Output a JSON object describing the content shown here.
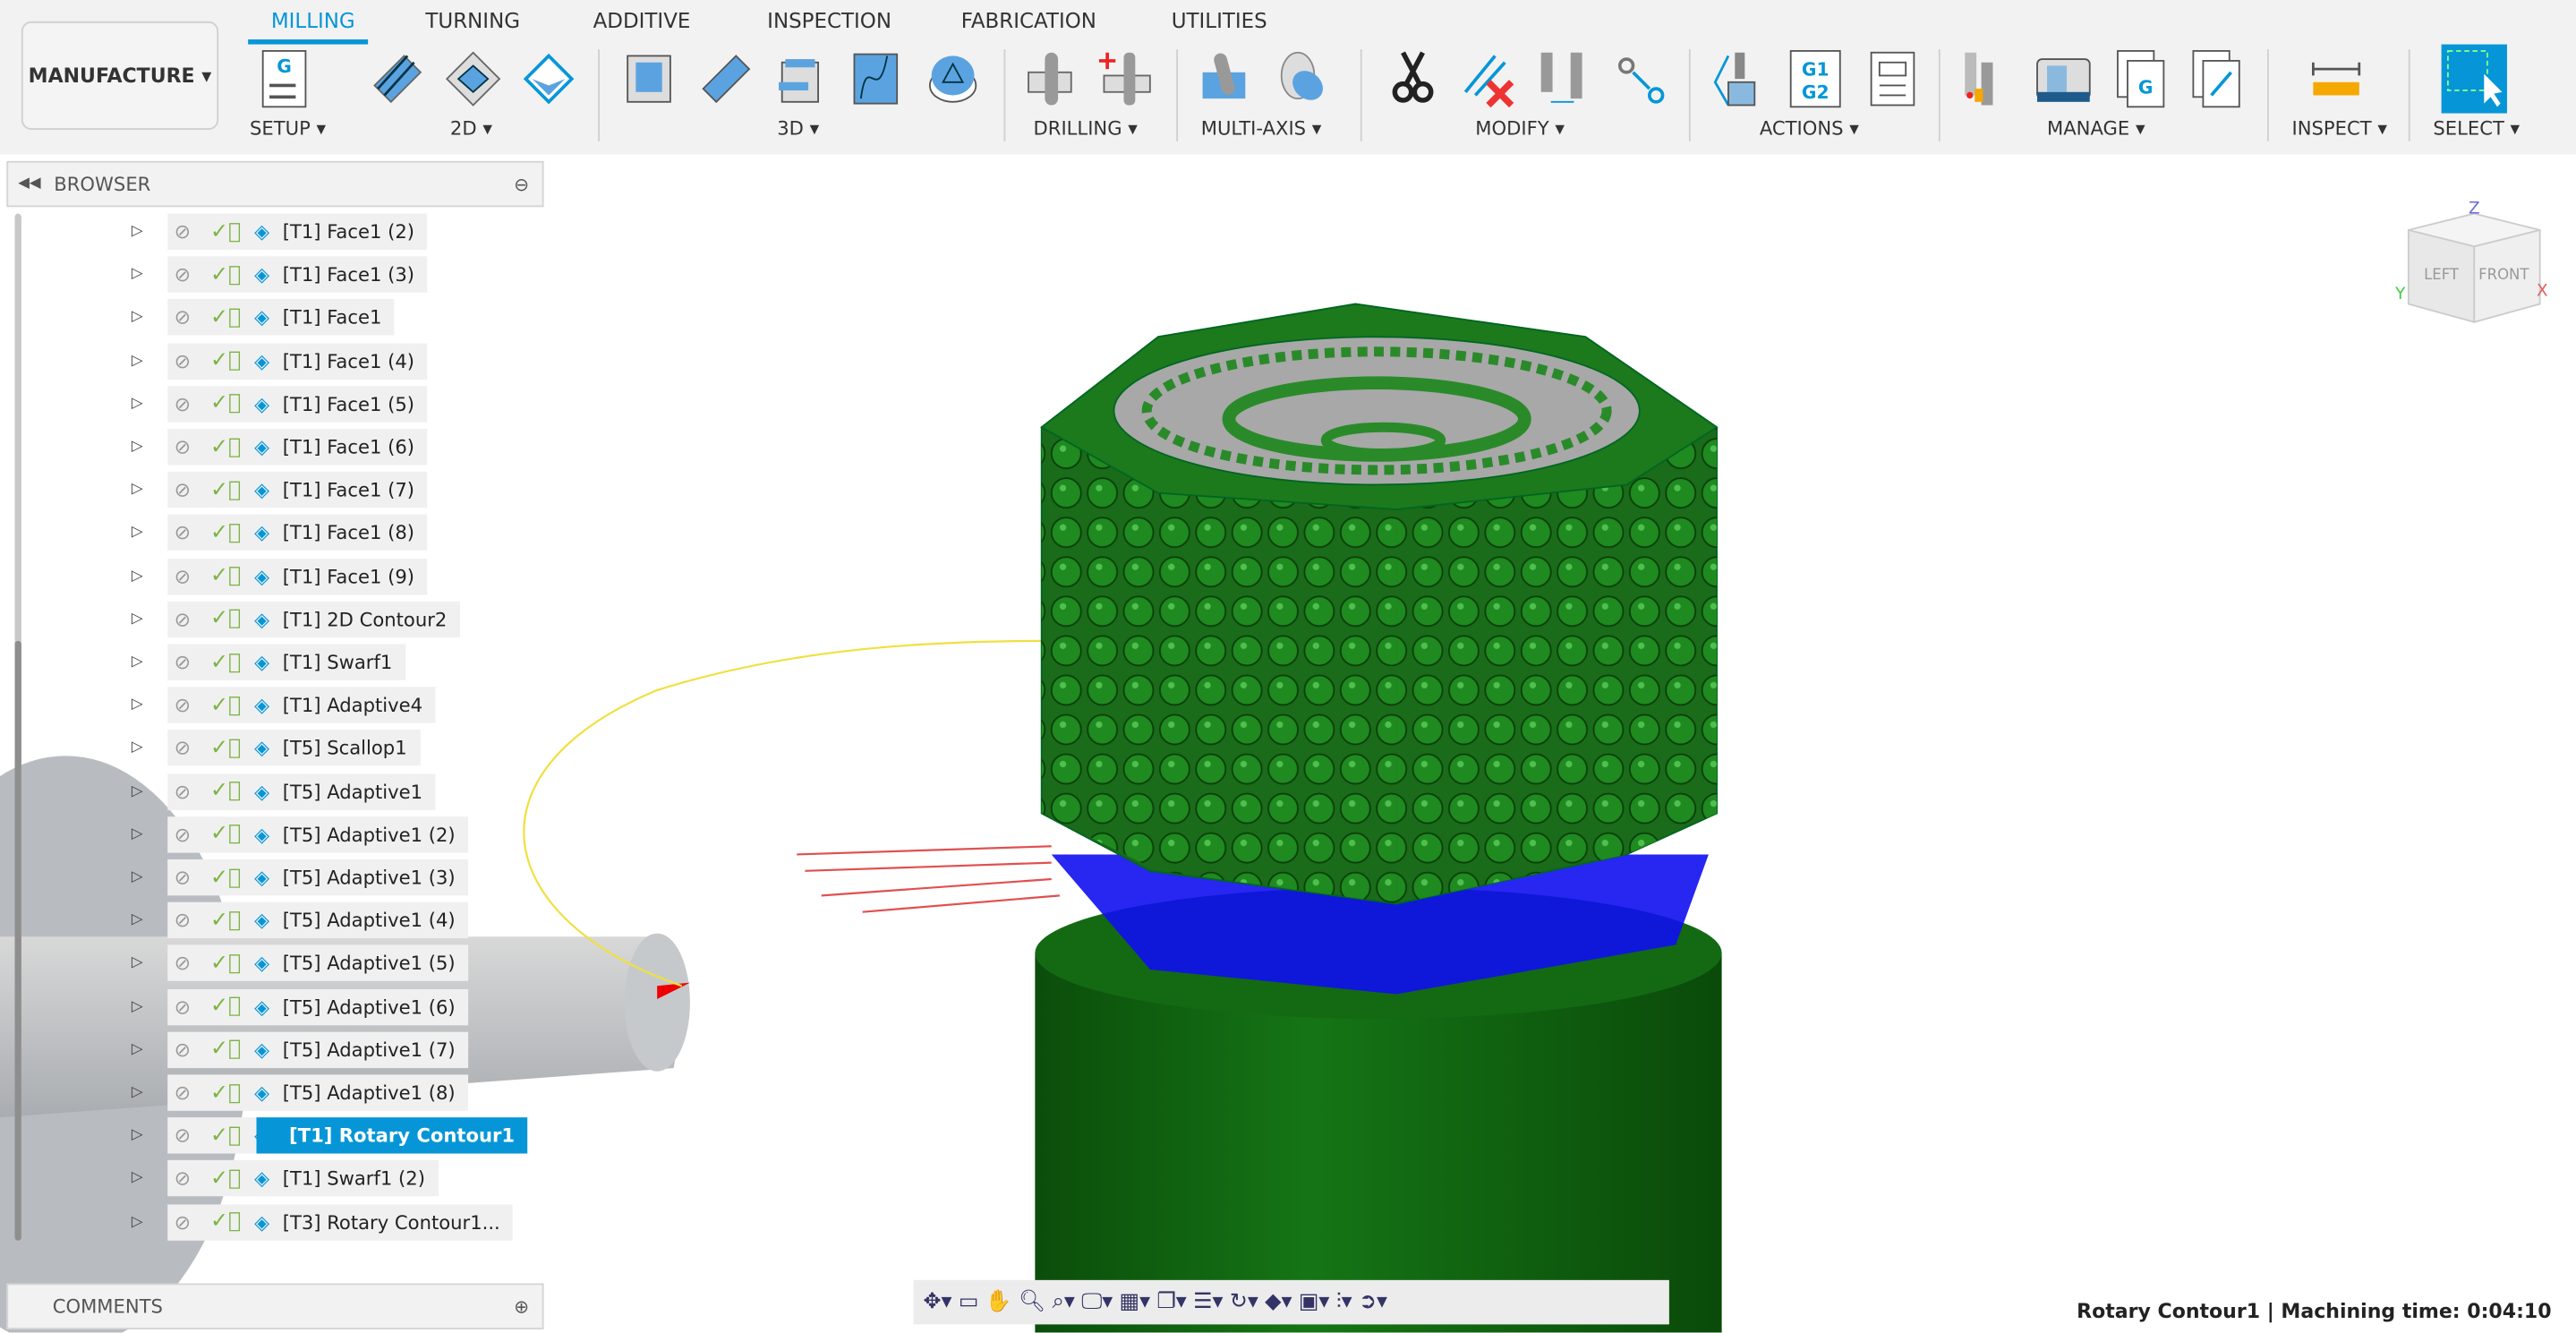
{
  "workspace": "MANUFACTURE",
  "tabs": [
    {
      "label": "MILLING",
      "active": true
    },
    {
      "label": "TURNING"
    },
    {
      "label": "ADDITIVE"
    },
    {
      "label": "INSPECTION"
    },
    {
      "label": "FABRICATION"
    },
    {
      "label": "UTILITIES"
    }
  ],
  "groups": [
    {
      "label": "SETUP"
    },
    {
      "label": "2D"
    },
    {
      "label": "3D"
    },
    {
      "label": "DRILLING"
    },
    {
      "label": "MULTI-AXIS"
    },
    {
      "label": "MODIFY"
    },
    {
      "label": "ACTIONS"
    },
    {
      "label": "MANAGE"
    },
    {
      "label": "INSPECT"
    },
    {
      "label": "SELECT"
    }
  ],
  "icon_text": {
    "setup_g": "G",
    "actions_g1": "G1",
    "actions_g2": "G2",
    "manage_g": "G"
  },
  "browser": {
    "title": "BROWSER",
    "items": [
      {
        "label": "[T1] Face1 (2)",
        "icon": "face-icon"
      },
      {
        "label": "[T1] Face1 (3)",
        "icon": "face-icon"
      },
      {
        "label": "[T1] Face1",
        "icon": "face-icon"
      },
      {
        "label": "[T1] Face1 (4)",
        "icon": "face-icon"
      },
      {
        "label": "[T1] Face1 (5)",
        "icon": "face-icon"
      },
      {
        "label": "[T1] Face1 (6)",
        "icon": "face-icon"
      },
      {
        "label": "[T1] Face1 (7)",
        "icon": "face-icon"
      },
      {
        "label": "[T1] Face1 (8)",
        "icon": "face-icon"
      },
      {
        "label": "[T1] Face1 (9)",
        "icon": "face-icon"
      },
      {
        "label": "[T1] 2D Contour2",
        "icon": "contour-icon"
      },
      {
        "label": "[T1] Swarf1",
        "icon": "swarf-icon"
      },
      {
        "label": "[T1] Adaptive4",
        "icon": "adaptive-icon"
      },
      {
        "label": "[T5] Scallop1",
        "icon": "scallop-icon"
      },
      {
        "label": "[T5] Adaptive1",
        "icon": "adaptive-icon"
      },
      {
        "label": "[T5] Adaptive1 (2)",
        "icon": "adaptive-icon"
      },
      {
        "label": "[T5] Adaptive1 (3)",
        "icon": "adaptive-icon"
      },
      {
        "label": "[T5] Adaptive1 (4)",
        "icon": "adaptive-icon"
      },
      {
        "label": "[T5] Adaptive1 (5)",
        "icon": "adaptive-icon"
      },
      {
        "label": "[T5] Adaptive1 (6)",
        "icon": "adaptive-icon"
      },
      {
        "label": "[T5] Adaptive1 (7)",
        "icon": "adaptive-icon"
      },
      {
        "label": "[T5] Adaptive1 (8)",
        "icon": "adaptive-icon"
      },
      {
        "label": "[T1] Rotary Contour1",
        "icon": "rotary-icon",
        "selected": true
      },
      {
        "label": "[T1] Swarf1 (2)",
        "icon": "swarf-icon"
      },
      {
        "label": "[T3] Rotary Contour1...",
        "icon": "rotary-icon"
      }
    ]
  },
  "comments": {
    "title": "COMMENTS"
  },
  "viewcube": {
    "left": "LEFT",
    "front": "FRONT",
    "z": "Z",
    "x": "X",
    "y": "Y"
  },
  "status": "Rotary Contour1 | Machining time: 0:04:10",
  "colors": {
    "accent": "#0696d7",
    "part": "#1a7a1a",
    "toolpath": "#0000ff"
  }
}
